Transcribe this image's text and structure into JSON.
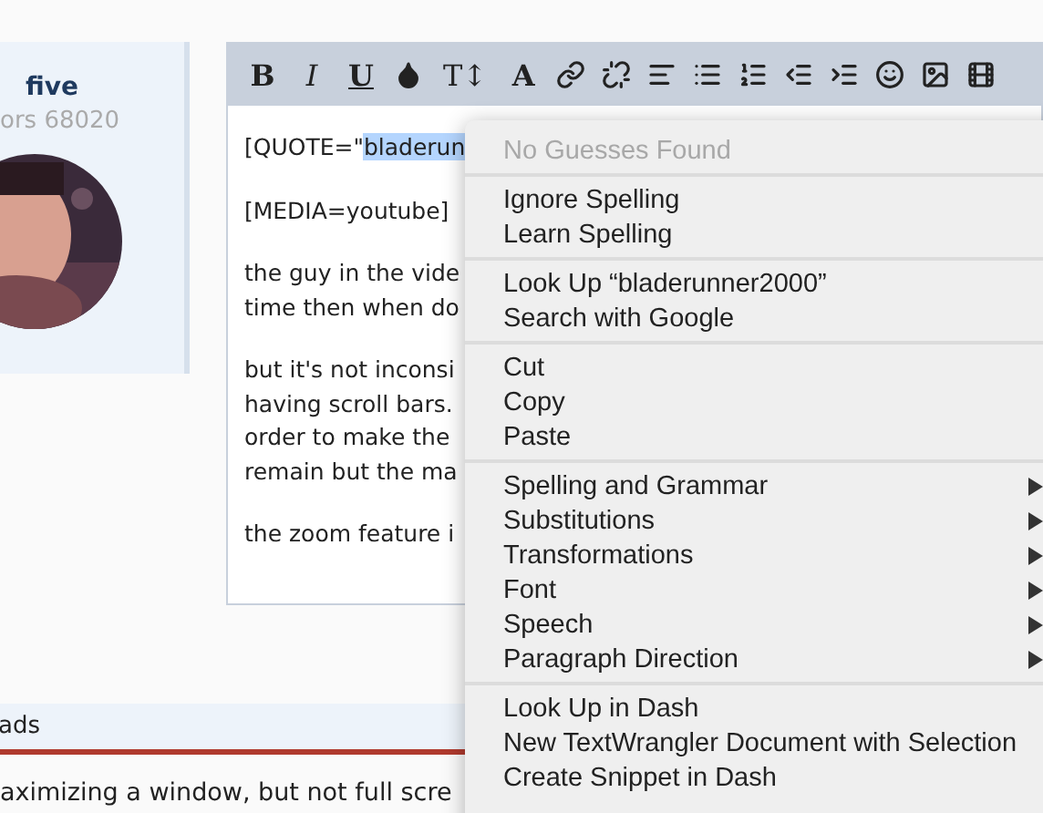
{
  "user_panel": {
    "name": "five",
    "stats": "ors 68020"
  },
  "toolbar": [
    {
      "kind": "text",
      "label": "B"
    },
    {
      "kind": "text",
      "label": "I"
    },
    {
      "kind": "text",
      "label": "U"
    },
    {
      "kind": "icon"
    },
    {
      "kind": "text",
      "label": "T↕"
    },
    {
      "kind": "text",
      "label": "A"
    },
    {
      "kind": "icon"
    },
    {
      "kind": "icon"
    },
    {
      "kind": "icon"
    },
    {
      "kind": "icon"
    },
    {
      "kind": "icon"
    },
    {
      "kind": "icon"
    },
    {
      "kind": "icon"
    },
    {
      "kind": "icon"
    },
    {
      "kind": "icon"
    },
    {
      "kind": "icon"
    }
  ],
  "editor_paragraphs": [
    [
      {
        "text": "[QUOTE=\"",
        "selected_text": "bladerun"
      }
    ],
    [
      {
        "text": "[MEDIA=youtube]"
      }
    ],
    [
      {
        "text": "the guy in the vide"
      },
      {
        "text": "time then when do"
      }
    ],
    [
      {
        "text": "but it's not inconsi"
      },
      {
        "text": "having scroll bars."
      },
      {
        "text": "order to make the"
      },
      {
        "text": "remain but the ma"
      }
    ],
    [
      {
        "text": "the zoom feature i"
      }
    ]
  ],
  "context_menu": [
    [
      {
        "label": "No Guesses Found",
        "disabled": true,
        "submenu": false
      }
    ],
    [
      {
        "label": "Ignore Spelling",
        "disabled": false,
        "submenu": false
      },
      {
        "label": "Learn Spelling",
        "disabled": false,
        "submenu": false
      }
    ],
    [
      {
        "label": "Look Up “bladerunner2000”",
        "disabled": false,
        "submenu": false
      },
      {
        "label": "Search with Google",
        "disabled": false,
        "submenu": false
      }
    ],
    [
      {
        "label": "Cut",
        "disabled": false,
        "submenu": false
      },
      {
        "label": "Copy",
        "disabled": false,
        "submenu": false
      },
      {
        "label": "Paste",
        "disabled": false,
        "submenu": false
      }
    ],
    [
      {
        "label": "Spelling and Grammar",
        "disabled": false,
        "submenu": true
      },
      {
        "label": "Substitutions",
        "disabled": false,
        "submenu": true
      },
      {
        "label": "Transformations",
        "disabled": false,
        "submenu": true
      },
      {
        "label": "Font",
        "disabled": false,
        "submenu": true
      },
      {
        "label": "Speech",
        "disabled": false,
        "submenu": true
      },
      {
        "label": "Paragraph Direction",
        "disabled": false,
        "submenu": true
      }
    ],
    [
      {
        "label": "Look Up in Dash",
        "disabled": false,
        "submenu": false
      },
      {
        "label": "New TextWrangler Document with Selection",
        "disabled": false,
        "submenu": false
      },
      {
        "label": "Create Snippet in Dash",
        "disabled": false,
        "submenu": false
      }
    ]
  ],
  "threads_bar": {
    "label": "ads"
  },
  "post_excerpt": "aximizing a window, but not full scre"
}
